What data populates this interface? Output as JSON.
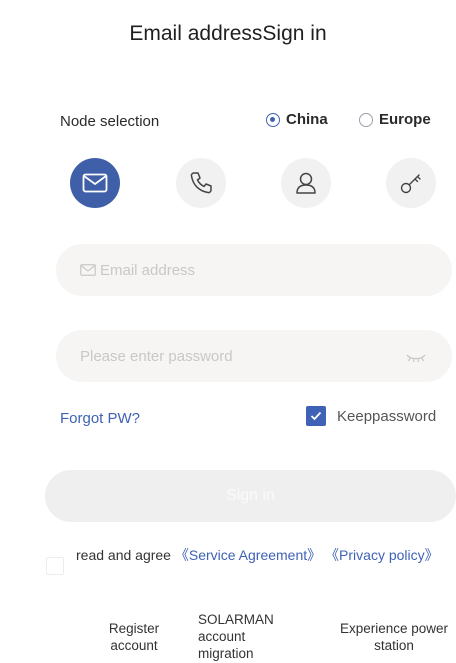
{
  "header": {
    "title": "Email addressSign in"
  },
  "node": {
    "label": "Node selection",
    "options": [
      {
        "label": "China",
        "selected": true
      },
      {
        "label": "Europe",
        "selected": false
      }
    ]
  },
  "login_methods": [
    {
      "icon": "envelope-icon",
      "active": true
    },
    {
      "icon": "phone-icon",
      "active": false
    },
    {
      "icon": "user-icon",
      "active": false
    },
    {
      "icon": "key-icon",
      "active": false
    }
  ],
  "form": {
    "email_placeholder": "Email address",
    "password_placeholder": "Please enter password",
    "forgot_label": "Forgot PW?",
    "keep_label": "Keeppassword",
    "keep_checked": true,
    "signin_label": "Sign in"
  },
  "agreement": {
    "prefix": "read and agree ",
    "service": "《Service Agreement》",
    "privacy": " 《Privacy policy》"
  },
  "bottom_links": {
    "register": "Register account",
    "migration": "SOLARMAN account migration",
    "experience": "Experience power station"
  },
  "colors": {
    "accent": "#3f62b6",
    "active_icon_bg": "#3f5fa8"
  }
}
